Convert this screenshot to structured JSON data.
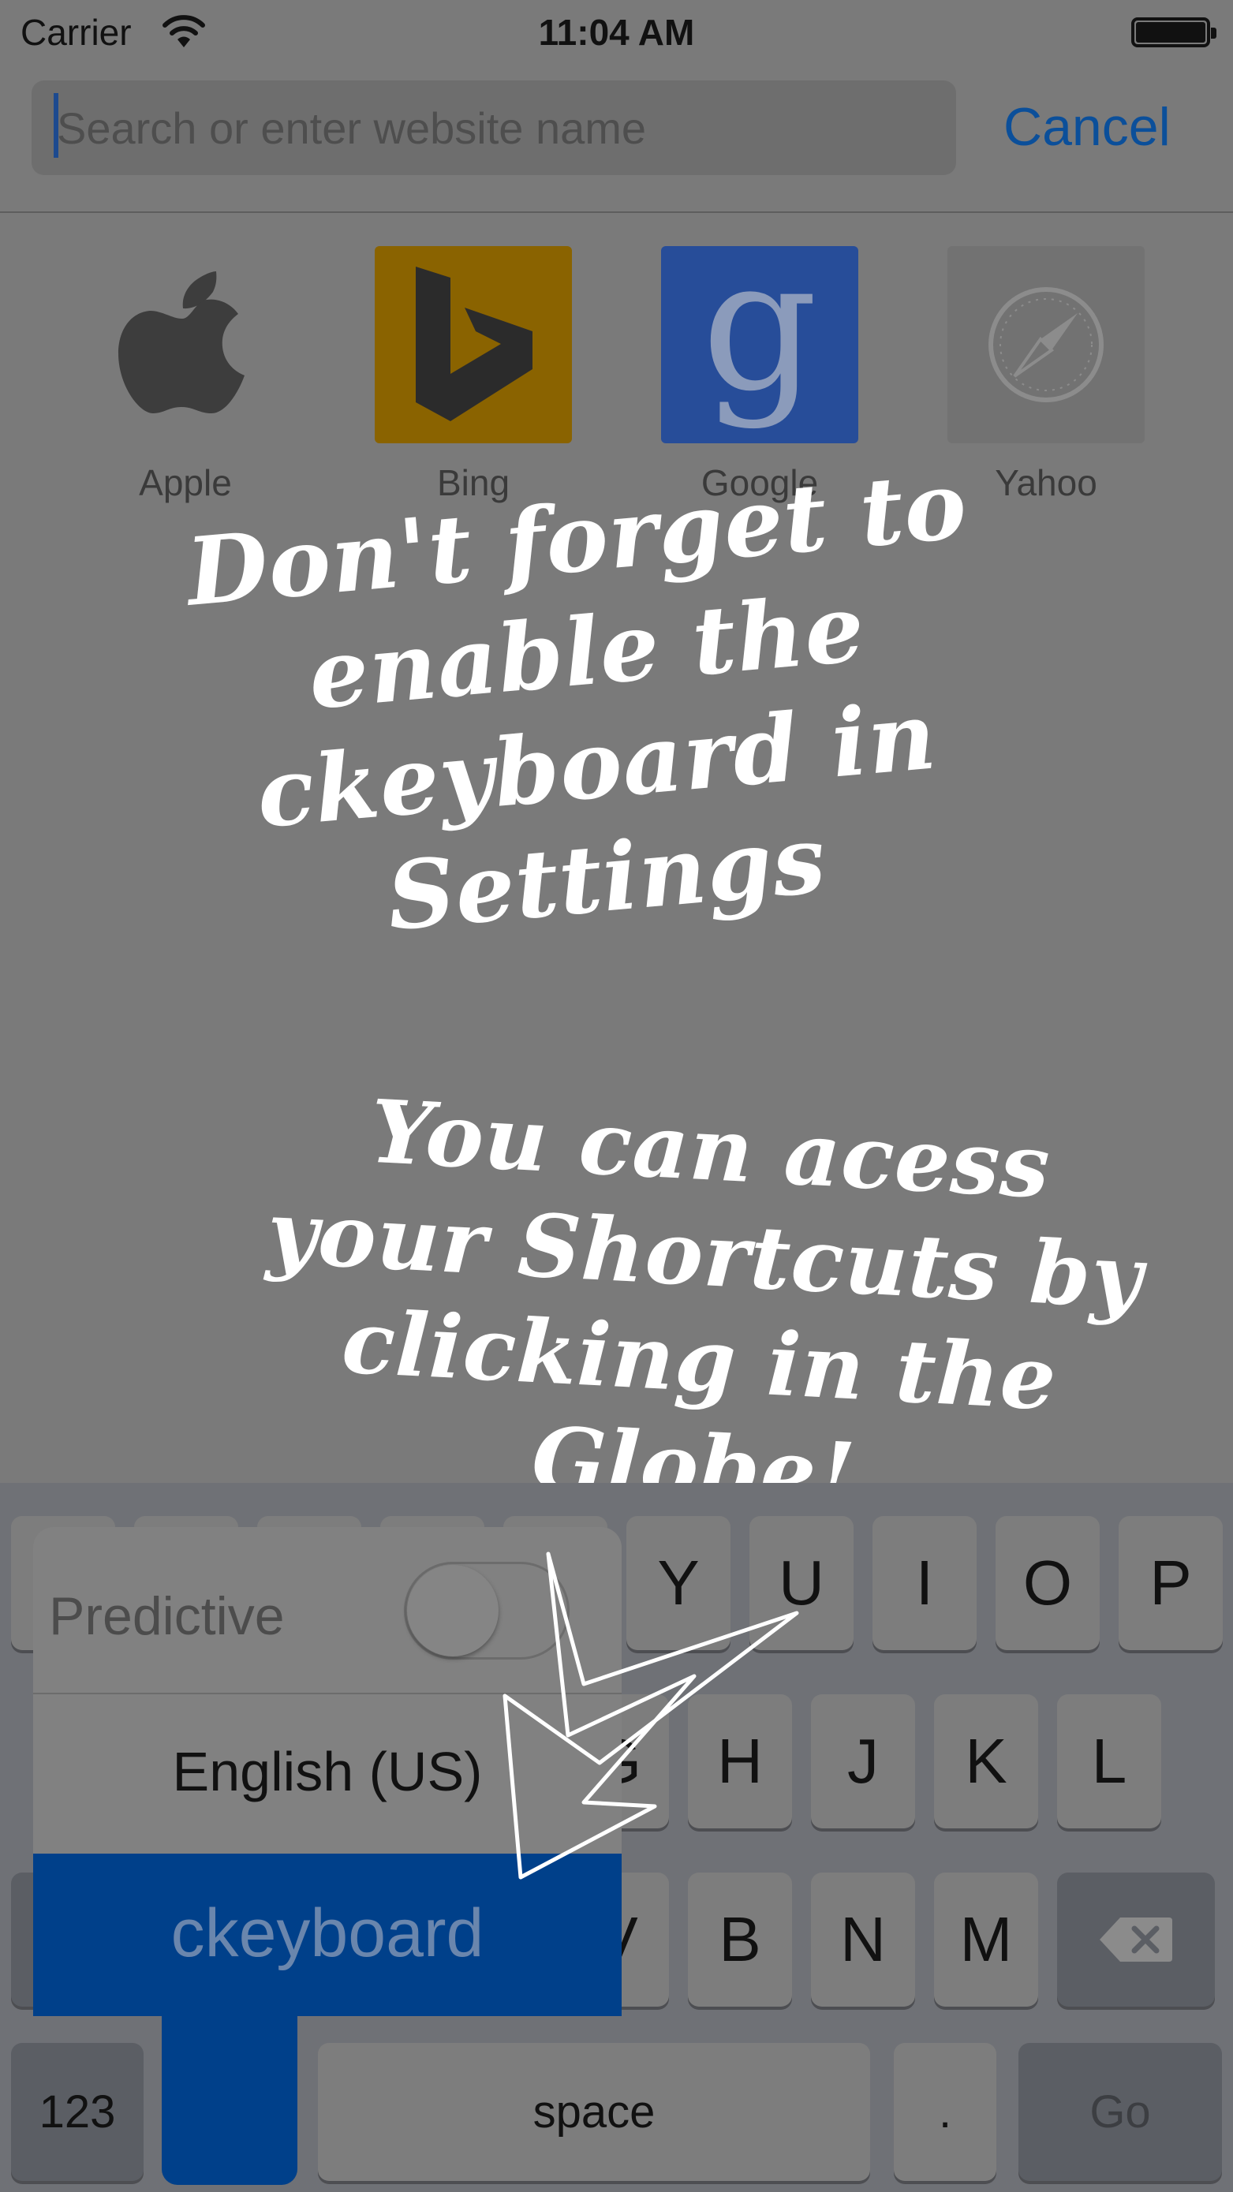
{
  "status_bar": {
    "carrier": "Carrier",
    "time": "11:04 AM"
  },
  "search": {
    "placeholder": "Search or enter website name",
    "cancel_label": "Cancel"
  },
  "favorites": [
    {
      "label": "Apple",
      "icon": "apple-icon"
    },
    {
      "label": "Bing",
      "icon": "bing-icon"
    },
    {
      "label": "Google",
      "icon": "google-icon"
    },
    {
      "label": "Yahoo",
      "icon": "compass-icon"
    }
  ],
  "notes": {
    "top": "Don't forget to enable the ckeyboard in Settings",
    "bottom": "You can acess your Shortcuts by clicking in the Globe!"
  },
  "keyboard": {
    "row1_visible": [
      "Y",
      "U",
      "I",
      "O",
      "P"
    ],
    "row2_visible": [
      "H",
      "J",
      "K",
      "L"
    ],
    "row3_visible": [
      "B",
      "N",
      "M"
    ],
    "numbers_label": "123",
    "space_label": "space",
    "period_label": ".",
    "go_label": "Go",
    "partial_g": "G",
    "partial_v": "V"
  },
  "input_menu": {
    "predictive_label": "Predictive",
    "predictive_on": false,
    "languages": [
      "English (US)",
      "ckeyboard"
    ],
    "selected": "ckeyboard"
  },
  "colors": {
    "accent": "#0b4f9a",
    "selected_keyboard": "#00408a"
  }
}
